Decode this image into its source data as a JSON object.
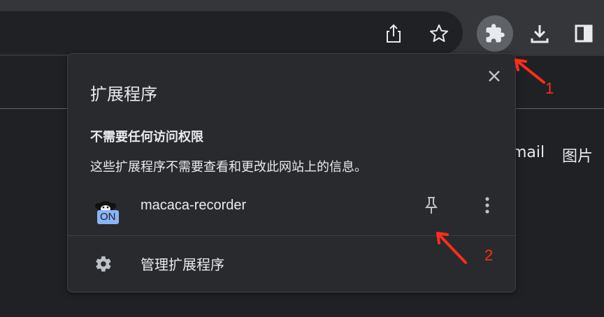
{
  "toolbar": {
    "icons": [
      "share-icon",
      "bookmark-star-icon",
      "extensions-puzzle-icon",
      "download-icon",
      "side-panel-icon"
    ]
  },
  "page": {
    "link_gmail": "mail",
    "link_images": "图片"
  },
  "popup": {
    "title": "扩展程序",
    "close_icon": "close-icon",
    "section_heading": "不需要任何访问权限",
    "section_description": "这些扩展程序不需要查看和更改此网站上的信息。",
    "extension": {
      "name": "macaca-recorder",
      "badge": "ON",
      "icon": "monkey-icon",
      "pin_icon": "pin-icon",
      "more_icon": "more-vert-icon"
    },
    "manage_label": "管理扩展程序",
    "manage_icon": "gear-icon"
  },
  "annotations": {
    "label_1": "1",
    "label_2": "2",
    "color": "#ff2d1a"
  },
  "colors": {
    "background": "#202124",
    "toolbar": "#35363a",
    "popup": "#292a2d",
    "badge": "#8ab4f8"
  }
}
